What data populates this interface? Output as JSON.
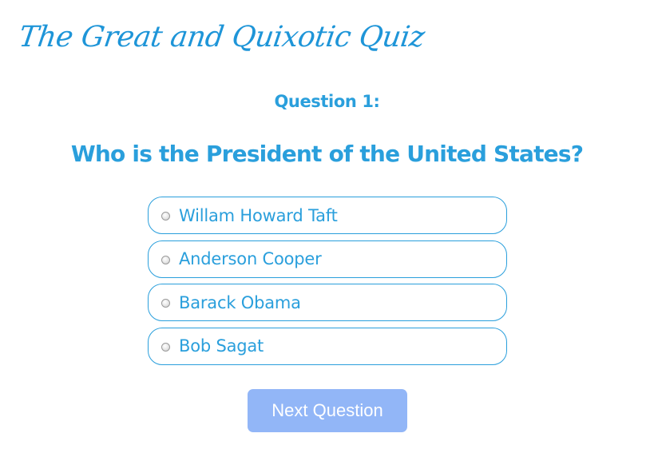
{
  "app": {
    "title": "The Great and Quixotic Quiz"
  },
  "quiz": {
    "question_number_label": "Question 1:",
    "question_text": "Who is the President of the United States?",
    "options": [
      {
        "label": "Willam Howard Taft",
        "selected": false
      },
      {
        "label": "Anderson Cooper",
        "selected": false
      },
      {
        "label": "Barack Obama",
        "selected": false
      },
      {
        "label": "Bob Sagat",
        "selected": false
      }
    ]
  },
  "actions": {
    "next_label": "Next Question"
  },
  "colors": {
    "accent": "#2a9fdc",
    "button_bg": "#92b6f7",
    "button_text": "#ffffff",
    "background": "#ffffff"
  }
}
